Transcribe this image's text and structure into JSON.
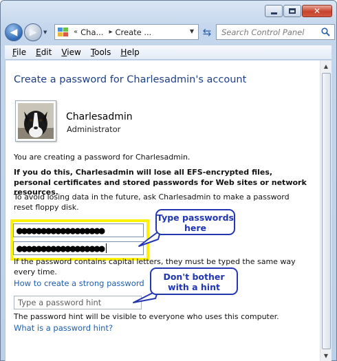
{
  "window": {
    "close_glyph": "✕"
  },
  "nav": {
    "back_glyph": "◀",
    "forward_glyph": "▶",
    "breadcrumb_chevron": "«",
    "breadcrumbs": [
      "Cha...",
      "Create ..."
    ],
    "refresh_glyph": "⇆",
    "search_placeholder": "Search Control Panel"
  },
  "menu": {
    "items": [
      {
        "label_rest": "ile",
        "hotkey": "F"
      },
      {
        "label_rest": "dit",
        "hotkey": "E"
      },
      {
        "label_rest": "iew",
        "hotkey": "V"
      },
      {
        "label_rest": "ools",
        "hotkey": "T"
      },
      {
        "label_rest": "elp",
        "hotkey": "H"
      }
    ]
  },
  "page": {
    "title": "Create a password for Charlesadmin's account",
    "user_name": "Charlesadmin",
    "user_role": "Administrator",
    "intro": "You are creating a password for Charlesadmin.",
    "warning": "If you do this, Charlesadmin will lose all EFS-encrypted files, personal certificates and stored passwords for Web sites or network resources.",
    "advice": "To avoid losing data in the future, ask Charlesadmin to make a password reset floppy disk.",
    "new_password_mask": "●●●●●●●●●●●●●●●●●●",
    "confirm_password_mask": "●●●●●●●●●●●●●●●●●●",
    "capital_note": "If the password contains capital letters, they must be typed the same way every time.",
    "strong_password_link": "How to create a strong password",
    "hint_placeholder": "Type a password hint",
    "hint_note": "The password hint will be visible to everyone who uses this computer.",
    "hint_link": "What is a password hint?"
  },
  "callouts": {
    "passwords": "Type passwords here",
    "hint": "Don't bother with a hint"
  },
  "icons": [
    "back-arrow-icon",
    "forward-arrow-icon",
    "control-panel-icon",
    "refresh-icon",
    "search-icon",
    "dog-avatar"
  ],
  "colors": {
    "title_blue": "#1e3f87",
    "link_blue": "#1c5db3",
    "highlight_yellow": "#fff200",
    "callout_blue": "#2336b0"
  }
}
